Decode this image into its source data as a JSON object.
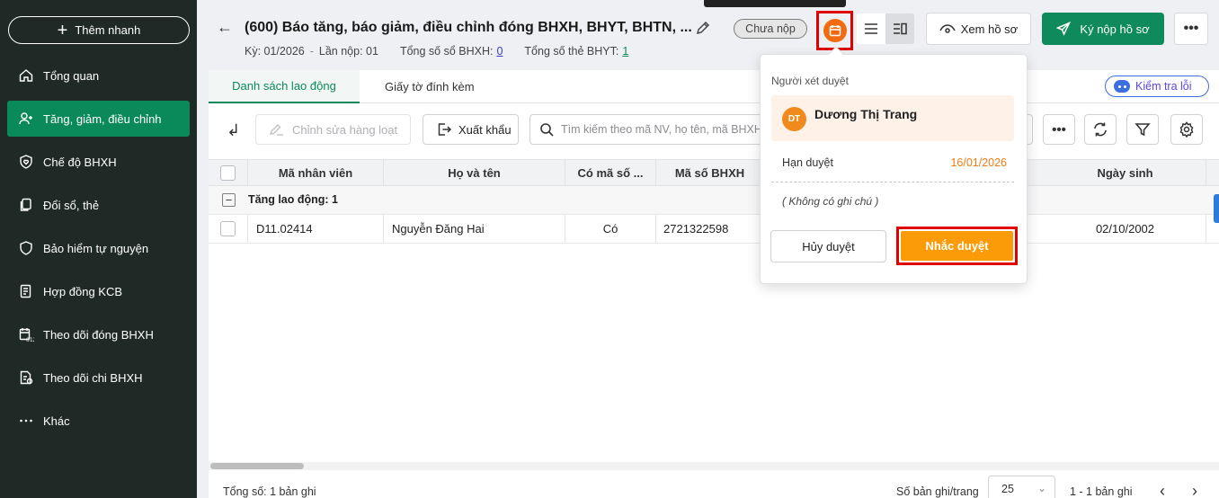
{
  "sidebar": {
    "quick_add": "Thêm nhanh",
    "items": [
      {
        "label": "Tổng quan",
        "icon": "home-icon"
      },
      {
        "label": "Tăng, giảm, điều chỉnh",
        "icon": "user-plus-icon"
      },
      {
        "label": "Chế độ BHXH",
        "icon": "shield-heart-icon"
      },
      {
        "label": "Đổi sổ, thẻ",
        "icon": "copy-card-icon"
      },
      {
        "label": "Bảo hiểm tự nguyện",
        "icon": "shield-icon"
      },
      {
        "label": "Hợp đồng KCB",
        "icon": "contract-icon"
      },
      {
        "label": "Theo dõi đóng BHXH",
        "icon": "calendar-track-icon"
      },
      {
        "label": "Theo dõi chi BHXH",
        "icon": "document-money-icon"
      },
      {
        "label": "Khác",
        "icon": "more-dots-icon"
      }
    ]
  },
  "header": {
    "title": "(600) Báo tăng, báo giảm, điều chỉnh đóng BHXH, BHYT, BHTN, ...",
    "period": "Kỳ: 01/2026",
    "submission": "Lần nộp: 01",
    "bhxh_label": "Tổng số sổ BHXH:",
    "bhxh_count": "0",
    "bhyt_label": "Tổng số thẻ BHYT:",
    "bhyt_count": "1",
    "status": "Chưa nộp",
    "view_button": "Xem hồ sơ",
    "sign_button": "Ký nộp hồ sơ"
  },
  "tabs": {
    "employees": "Danh sách lao động",
    "attachments": "Giấy tờ đính kèm",
    "check_errors": "Kiểm tra lỗi"
  },
  "toolbar": {
    "bulk_edit": "Chỉnh sửa hàng loạt",
    "export": "Xuất khẩu",
    "search_placeholder": "Tìm kiếm theo mã NV, họ tên, mã BHXH"
  },
  "table": {
    "columns": [
      "Mã nhân viên",
      "Họ và tên",
      "Có mã số ...",
      "Mã số BHXH",
      "Ngày sinh"
    ],
    "group_label": "Tăng lao động: 1",
    "rows": [
      {
        "employee_id": "D11.02414",
        "name": "Nguyễn Đăng Hai",
        "has_code": "Có",
        "bhxh_code": "2721322598",
        "dob": "02/10/2002"
      }
    ]
  },
  "footer": {
    "total": "Tổng số: 1 bản ghi",
    "per_page_label": "Số bản ghi/trang",
    "per_page_value": "25",
    "range": "1 - 1 bản ghi"
  },
  "popover": {
    "heading": "Người xét duyệt",
    "reviewer_initials": "DT",
    "reviewer_name": "Dương Thị Trang",
    "deadline_label": "Hạn duyệt",
    "deadline_value": "16/01/2026",
    "note": "( Không có ghi chú )",
    "cancel_button": "Hủy duyệt",
    "remind_button": "Nhắc duyệt"
  },
  "colors": {
    "sidebar_bg": "#1f2a27",
    "accent_green": "#0a8a5a",
    "orange": "#f26b10",
    "remind_orange": "#fb9b07",
    "highlight_red": "#e00000"
  }
}
